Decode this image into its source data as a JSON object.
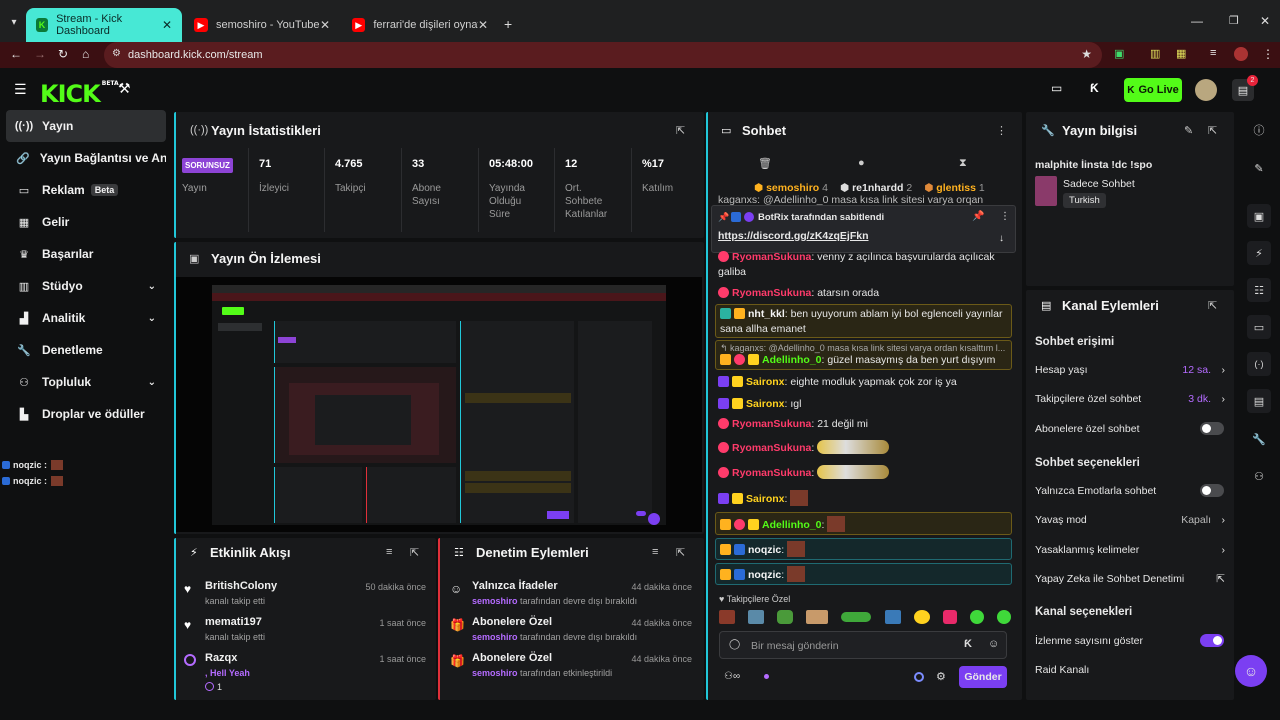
{
  "browser": {
    "tabs": [
      {
        "title": "Stream - Kick Dashboard"
      },
      {
        "title": "semoshiro - YouTube"
      },
      {
        "title": "ferrari'de dişileri oynatma zorlu"
      }
    ],
    "url": "dashboard.kick.com/stream"
  },
  "header": {
    "logo": "KICK",
    "logo_beta": "BETA",
    "go_live_label": "Go Live",
    "notification_count": "2"
  },
  "sidebar": {
    "items": [
      {
        "label": "Yayın",
        "icon": "broadcast-icon"
      },
      {
        "label": "Yayın Bağlantısı ve Anahtarı",
        "icon": "link-icon"
      },
      {
        "label": "Reklam",
        "icon": "ad-icon",
        "badge": "Beta"
      },
      {
        "label": "Gelir",
        "icon": "revenue-icon"
      },
      {
        "label": "Başarılar",
        "icon": "trophy-icon"
      },
      {
        "label": "Stüdyo",
        "icon": "studio-icon"
      },
      {
        "label": "Analitik",
        "icon": "analytics-icon"
      },
      {
        "label": "Denetleme",
        "icon": "wrench-icon"
      },
      {
        "label": "Topluluk",
        "icon": "community-icon"
      },
      {
        "label": "Droplar ve ödüller",
        "icon": "drops-icon"
      }
    ],
    "mini_chat": [
      {
        "user": "noqzic :"
      },
      {
        "user": "noqzic :"
      }
    ]
  },
  "stats": {
    "title": "Yayın İstatistikleri",
    "status_badge": "SORUNSUZ",
    "status_label": "Yayın",
    "columns": [
      {
        "value": "71",
        "label": "İzleyici"
      },
      {
        "value": "4.765",
        "label": "Takipçi"
      },
      {
        "value": "33",
        "label": "Abone Sayısı"
      },
      {
        "value": "05:48:00",
        "label": "Yayında Olduğu Süre"
      },
      {
        "value": "12",
        "label": "Ort. Sohbete Katılanlar"
      },
      {
        "value": "%17",
        "label": "Katılım"
      }
    ]
  },
  "preview": {
    "title": "Yayın Ön İzlemesi"
  },
  "activity": {
    "title": "Etkinlik Akışı",
    "items": [
      {
        "user": "BritishColony",
        "desc": "kanalı takip etti",
        "time": "50 dakika önce"
      },
      {
        "user": "memati197",
        "desc": "kanalı takip etti",
        "time": "1 saat önce"
      },
      {
        "user": "Razqx",
        "desc": ", Hell Yeah",
        "extra": "1",
        "time": "1 saat önce"
      }
    ]
  },
  "moderation": {
    "title": "Denetim Eylemleri",
    "items": [
      {
        "action": "Yalnızca İfadeler",
        "actor": "semoshiro",
        "desc": "tarafından devre dışı bırakıldı",
        "time": "44 dakika önce"
      },
      {
        "action": "Abonelere Özel",
        "actor": "semoshiro",
        "desc": "tarafından devre dışı bırakıldı",
        "time": "44 dakika önce"
      },
      {
        "action": "Abonelere Özel",
        "actor": "semoshiro",
        "desc": "tarafından etkinleştirildi",
        "time": "44 dakika önce"
      }
    ]
  },
  "chat": {
    "title": "Sohbet",
    "top_chatters": [
      {
        "name": "semoshiro",
        "count": "4"
      },
      {
        "name": "re1nhardd",
        "count": "2"
      },
      {
        "name": "glentiss",
        "count": "1"
      }
    ],
    "pinned": {
      "header": "BotRix tarafından sabitlendi",
      "link": "https://discord.gg/zK4zqEjFkn"
    },
    "behind_pinned": "kaganxs: @Adellinho_0 masa kısa link sitesi varya orqan",
    "messages": [
      {
        "user": "RyomanSukuna",
        "text": ": venny z açılınca başvurularda açılıcak galiba",
        "color": "#ff3b6b"
      },
      {
        "user": "RyomanSukuna",
        "text": ": atarsın orada",
        "color": "#ff3b6b"
      },
      {
        "user": "nht_kkl",
        "text": ": ben uyuyorum ablam iyi bol eglenceli yayınlar sana allha emanet",
        "color": "#f5f5f5"
      },
      {
        "reply": "kaganxs: @Adellinho_0 masa kısa link sitesi varya ordan kısalttım l...",
        "user": "Adellinho_0",
        "text": ": güzel masaymış da ben yurt dışıyım",
        "color": "#53fc18"
      },
      {
        "user": "Saironx",
        "text": ": eighte modluk yapmak çok zor iş ya",
        "color": "#ffd21f"
      },
      {
        "user": "Saironx",
        "text": ": ıgl",
        "color": "#ffd21f"
      },
      {
        "user": "RyomanSukuna",
        "text": ": 21 değil mi",
        "color": "#ff3b6b"
      },
      {
        "user": "RyomanSukuna",
        "text": ":",
        "color": "#ff3b6b"
      },
      {
        "user": "RyomanSukuna",
        "text": ":",
        "color": "#ff3b6b"
      },
      {
        "user": "Saironx",
        "text": ":",
        "color": "#ffd21f"
      },
      {
        "user": "Adellinho_0",
        "text": ":",
        "color": "#53fc18"
      },
      {
        "user": "noqzic",
        "text": ":",
        "color": "#f5f5f5"
      },
      {
        "user": "noqzic",
        "text": ":",
        "color": "#f5f5f5"
      }
    ],
    "followers_only": "Takipçilere Özel",
    "input_placeholder": "Bir mesaj gönderin",
    "send_label": "Gönder"
  },
  "stream_info": {
    "title": "Yayın bilgisi",
    "stream_title": "malphite İinsta !dc !spo",
    "category": "Sadece Sohbet",
    "tag": "Turkish"
  },
  "channel_actions": {
    "title": "Kanal Eylemleri",
    "chat_access_title": "Sohbet erişimi",
    "account_age_label": "Hesap yaşı",
    "account_age_value": "12 sa.",
    "followers_only_label": "Takipçilere özel sohbet",
    "followers_only_value": "3 dk.",
    "subs_only_label": "Abonelere özel sohbet",
    "chat_options_title": "Sohbet seçenekleri",
    "emote_only_label": "Yalnızca Emotlarla sohbet",
    "slow_mode_label": "Yavaş mod",
    "slow_mode_value": "Kapalı",
    "banned_words_label": "Yasaklanmış kelimeler",
    "ai_mod_label": "Yapay Zeka ile Sohbet Denetimi",
    "channel_options_title": "Kanal seçenekleri",
    "show_viewers_label": "İzlenme sayısını göster",
    "raid_label": "Raid Kanalı"
  },
  "colors": {
    "brand": "#53fc18",
    "accent": "#7b3ff2",
    "tab_active": "#47e8d5",
    "address_bar": "#3b0f12"
  }
}
